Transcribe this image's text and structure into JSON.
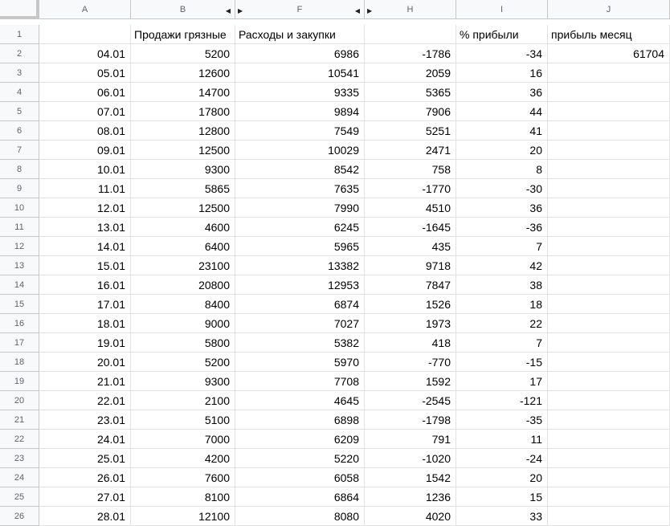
{
  "columns": {
    "A": "A",
    "B": "B",
    "F": "F",
    "H": "H",
    "I": "I",
    "J": "J",
    "hidden_arrow_left": "◀",
    "hidden_arrow_right": "▶"
  },
  "header_row": {
    "num": "1",
    "A": "",
    "B": "Продажи грязные",
    "F": "Расходы и закупки",
    "H": "",
    "I": "% прибыли",
    "J": "прибыль месяц"
  },
  "rows": [
    {
      "num": "2",
      "A": "04.01",
      "B": "5200",
      "F": "6986",
      "H": "-1786",
      "I": "-34",
      "J": "61704"
    },
    {
      "num": "3",
      "A": "05.01",
      "B": "12600",
      "F": "10541",
      "H": "2059",
      "I": "16",
      "J": ""
    },
    {
      "num": "4",
      "A": "06.01",
      "B": "14700",
      "F": "9335",
      "H": "5365",
      "I": "36",
      "J": ""
    },
    {
      "num": "5",
      "A": "07.01",
      "B": "17800",
      "F": "9894",
      "H": "7906",
      "I": "44",
      "J": ""
    },
    {
      "num": "6",
      "A": "08.01",
      "B": "12800",
      "F": "7549",
      "H": "5251",
      "I": "41",
      "J": ""
    },
    {
      "num": "7",
      "A": "09.01",
      "B": "12500",
      "F": "10029",
      "H": "2471",
      "I": "20",
      "J": ""
    },
    {
      "num": "8",
      "A": "10.01",
      "B": "9300",
      "F": "8542",
      "H": "758",
      "I": "8",
      "J": ""
    },
    {
      "num": "9",
      "A": "11.01",
      "B": "5865",
      "F": "7635",
      "H": "-1770",
      "I": "-30",
      "J": ""
    },
    {
      "num": "10",
      "A": "12.01",
      "B": "12500",
      "F": "7990",
      "H": "4510",
      "I": "36",
      "J": ""
    },
    {
      "num": "11",
      "A": "13.01",
      "B": "4600",
      "F": "6245",
      "H": "-1645",
      "I": "-36",
      "J": ""
    },
    {
      "num": "12",
      "A": "14.01",
      "B": "6400",
      "F": "5965",
      "H": "435",
      "I": "7",
      "J": ""
    },
    {
      "num": "13",
      "A": "15.01",
      "B": "23100",
      "F": "13382",
      "H": "9718",
      "I": "42",
      "J": ""
    },
    {
      "num": "14",
      "A": "16.01",
      "B": "20800",
      "F": "12953",
      "H": "7847",
      "I": "38",
      "J": ""
    },
    {
      "num": "15",
      "A": "17.01",
      "B": "8400",
      "F": "6874",
      "H": "1526",
      "I": "18",
      "J": ""
    },
    {
      "num": "16",
      "A": "18.01",
      "B": "9000",
      "F": "7027",
      "H": "1973",
      "I": "22",
      "J": ""
    },
    {
      "num": "17",
      "A": "19.01",
      "B": "5800",
      "F": "5382",
      "H": "418",
      "I": "7",
      "J": ""
    },
    {
      "num": "18",
      "A": "20.01",
      "B": "5200",
      "F": "5970",
      "H": "-770",
      "I": "-15",
      "J": ""
    },
    {
      "num": "19",
      "A": "21.01",
      "B": "9300",
      "F": "7708",
      "H": "1592",
      "I": "17",
      "J": ""
    },
    {
      "num": "20",
      "A": "22.01",
      "B": "2100",
      "F": "4645",
      "H": "-2545",
      "I": "-121",
      "J": ""
    },
    {
      "num": "21",
      "A": "23.01",
      "B": "5100",
      "F": "6898",
      "H": "-1798",
      "I": "-35",
      "J": ""
    },
    {
      "num": "22",
      "A": "24.01",
      "B": "7000",
      "F": "6209",
      "H": "791",
      "I": "11",
      "J": ""
    },
    {
      "num": "23",
      "A": "25.01",
      "B": "4200",
      "F": "5220",
      "H": "-1020",
      "I": "-24",
      "J": ""
    },
    {
      "num": "24",
      "A": "26.01",
      "B": "7600",
      "F": "6058",
      "H": "1542",
      "I": "20",
      "J": ""
    },
    {
      "num": "25",
      "A": "27.01",
      "B": "8100",
      "F": "6864",
      "H": "1236",
      "I": "15",
      "J": ""
    },
    {
      "num": "26",
      "A": "28.01",
      "B": "12100",
      "F": "8080",
      "H": "4020",
      "I": "33",
      "J": ""
    }
  ]
}
